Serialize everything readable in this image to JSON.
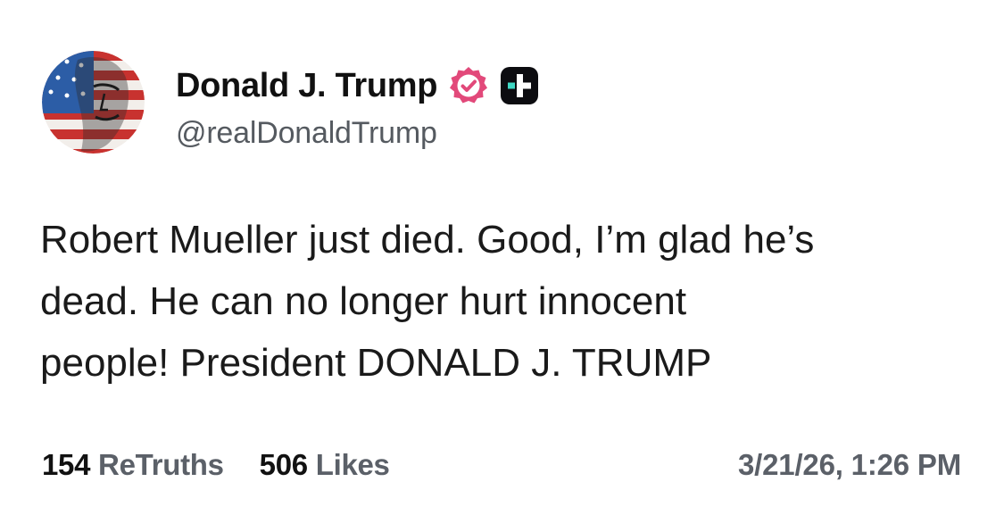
{
  "post": {
    "author": {
      "display_name": "Donald J. Trump",
      "handle": "@realDonaldTrump",
      "avatar_icon": "profile-avatar",
      "verified_icon": "verified-badge-icon",
      "plus_icon": "plus-badge-icon"
    },
    "text": "Robert Mueller just died. Good, I’m glad he’s\ndead. He can no longer hurt innocent\npeople! President DONALD J. TRUMP",
    "stats": {
      "retruths_count": "154",
      "retruths_label": "ReTruths",
      "likes_count": "506",
      "likes_label": "Likes"
    },
    "timestamp": "3/21/26, 1:26 PM"
  },
  "colors": {
    "verified_badge": "#e2497a",
    "plus_badge": "#0c0c10",
    "plus_badge_accent": "#3fd8c4",
    "secondary_text": "#5b6068",
    "primary_text": "#111111"
  }
}
